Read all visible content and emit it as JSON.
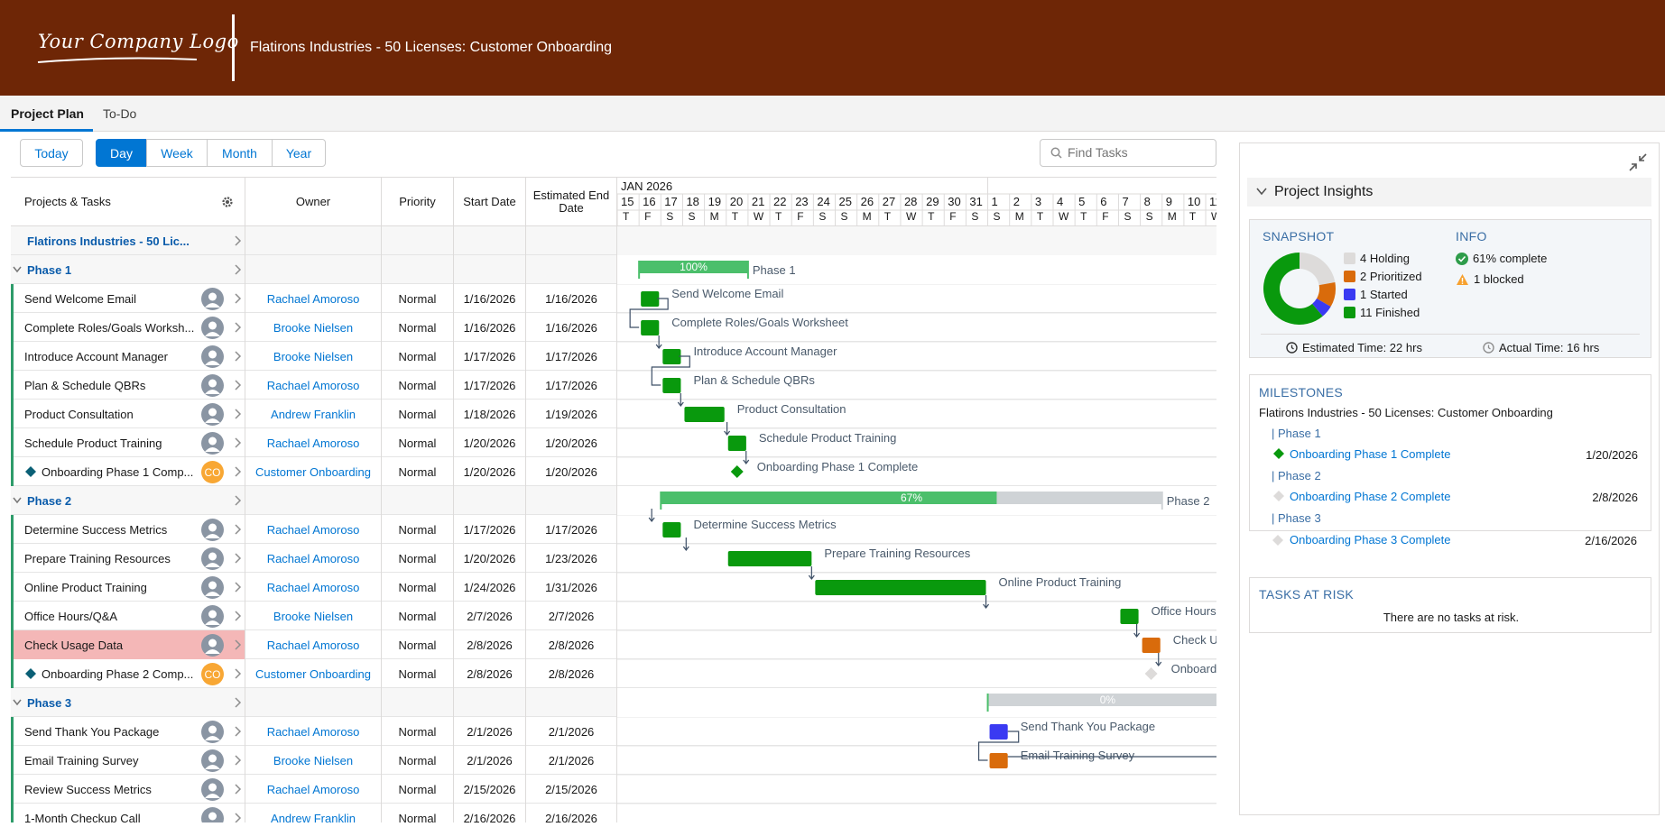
{
  "header": {
    "logo_text": "Your Company Logo",
    "title": "Flatirons Industries - 50 Licenses: Customer Onboarding"
  },
  "tabs": [
    {
      "label": "Project Plan",
      "active": true
    },
    {
      "label": "To-Do",
      "active": false
    }
  ],
  "toolbar": {
    "today": "Today",
    "views": [
      "Day",
      "Week",
      "Month",
      "Year"
    ],
    "active_view": "Day",
    "search_placeholder": "Find Tasks"
  },
  "grid": {
    "columns": [
      "Projects & Tasks",
      "Owner",
      "Priority",
      "Start Date",
      "Estimated End Date"
    ],
    "month_label": "JAN 2026",
    "days": [
      "15",
      "16",
      "17",
      "18",
      "19",
      "20",
      "21",
      "22",
      "23",
      "24",
      "25",
      "26",
      "27",
      "28",
      "29",
      "30",
      "31",
      "1",
      "2",
      "3",
      "4",
      "5",
      "6",
      "7",
      "8",
      "9",
      "10",
      "11"
    ],
    "weekdays": [
      "T",
      "F",
      "S",
      "S",
      "M",
      "T",
      "W",
      "T",
      "F",
      "S",
      "S",
      "M",
      "T",
      "W",
      "T",
      "F",
      "S",
      "S",
      "M",
      "T",
      "W",
      "T",
      "F",
      "S",
      "S",
      "M",
      "T",
      "W"
    ],
    "rows": [
      {
        "type": "project",
        "name": "Flatirons Industries - 50 Lic..."
      },
      {
        "type": "phase",
        "name": "Phase 1",
        "bar_label": "100%",
        "percent": 100,
        "gantt_label": "Phase 1"
      },
      {
        "type": "task",
        "name": "Send Welcome Email",
        "owner": "Rachael Amoroso",
        "priority": "Normal",
        "start": "1/16/2026",
        "end": "1/16/2026",
        "status": "finished"
      },
      {
        "type": "task",
        "name": "Complete Roles/Goals Worksh...",
        "gantt_label": "Complete Roles/Goals Worksheet",
        "owner": "Brooke Nielsen",
        "priority": "Normal",
        "start": "1/16/2026",
        "end": "1/16/2026",
        "status": "finished"
      },
      {
        "type": "task",
        "name": "Introduce Account Manager",
        "owner": "Brooke Nielsen",
        "priority": "Normal",
        "start": "1/17/2026",
        "end": "1/17/2026",
        "status": "finished"
      },
      {
        "type": "task",
        "name": "Plan & Schedule QBRs",
        "owner": "Rachael Amoroso",
        "priority": "Normal",
        "start": "1/17/2026",
        "end": "1/17/2026",
        "status": "finished"
      },
      {
        "type": "task",
        "name": "Product Consultation",
        "owner": "Andrew Franklin",
        "priority": "Normal",
        "start": "1/18/2026",
        "end": "1/19/2026",
        "status": "finished"
      },
      {
        "type": "task",
        "name": "Schedule Product Training",
        "owner": "Rachael Amoroso",
        "priority": "Normal",
        "start": "1/20/2026",
        "end": "1/20/2026",
        "status": "finished"
      },
      {
        "type": "milestone",
        "name": "Onboarding Phase 1 Comp...",
        "gantt_label": "Onboarding Phase 1 Complete",
        "owner": "Customer Onboarding",
        "avatar_initials": "CO",
        "priority": "Normal",
        "start": "1/20/2026",
        "end": "1/20/2026",
        "status": "finished"
      },
      {
        "type": "phase",
        "name": "Phase 2",
        "bar_label": "67%",
        "percent": 67,
        "gantt_label": "Phase 2"
      },
      {
        "type": "task",
        "name": "Determine Success Metrics",
        "owner": "Rachael Amoroso",
        "priority": "Normal",
        "start": "1/17/2026",
        "end": "1/17/2026",
        "status": "finished"
      },
      {
        "type": "task",
        "name": "Prepare Training Resources",
        "owner": "Rachael Amoroso",
        "priority": "Normal",
        "start": "1/20/2026",
        "end": "1/23/2026",
        "status": "finished"
      },
      {
        "type": "task",
        "name": "Online Product Training",
        "owner": "Rachael Amoroso",
        "priority": "Normal",
        "start": "1/24/2026",
        "end": "1/31/2026",
        "status": "finished"
      },
      {
        "type": "task",
        "name": "Office Hours/Q&A",
        "gantt_label": "Office Hours",
        "owner": "Brooke Nielsen",
        "priority": "Normal",
        "start": "2/7/2026",
        "end": "2/7/2026",
        "status": "finished"
      },
      {
        "type": "task",
        "name": "Check Usage Data",
        "gantt_label": "Check U",
        "owner": "Rachael Amoroso",
        "priority": "Normal",
        "start": "2/8/2026",
        "end": "2/8/2026",
        "status": "prioritized",
        "at_risk_highlight": true
      },
      {
        "type": "milestone",
        "name": "Onboarding Phase 2 Comp...",
        "gantt_label": "Onboard",
        "owner": "Customer Onboarding",
        "avatar_initials": "CO",
        "priority": "Normal",
        "start": "2/8/2026",
        "end": "2/8/2026",
        "status": "holding"
      },
      {
        "type": "phase",
        "name": "Phase 3",
        "bar_label": "0%",
        "percent": 0
      },
      {
        "type": "task",
        "name": "Send Thank You Package",
        "owner": "Rachael Amoroso",
        "priority": "Normal",
        "start": "2/1/2026",
        "end": "2/1/2026",
        "status": "started"
      },
      {
        "type": "task",
        "name": "Email Training Survey",
        "owner": "Brooke Nielsen",
        "priority": "Normal",
        "start": "2/1/2026",
        "end": "2/1/2026",
        "status": "prioritized"
      },
      {
        "type": "task",
        "name": "Review Success Metrics",
        "owner": "Rachael Amoroso",
        "priority": "Normal",
        "start": "2/15/2026",
        "end": "2/15/2026",
        "status": "holding"
      },
      {
        "type": "task",
        "name": "1-Month Checkup Call",
        "owner": "Andrew Franklin",
        "priority": "Normal",
        "start": "2/16/2026",
        "end": "2/16/2026",
        "status": "holding"
      }
    ]
  },
  "insights": {
    "title": "Project Insights",
    "snapshot_label": "SNAPSHOT",
    "info_label": "INFO",
    "legend": [
      {
        "label": "4 Holding",
        "count": 4,
        "color": "#dddbda"
      },
      {
        "label": "2 Prioritized",
        "count": 2,
        "color": "#d96b0b"
      },
      {
        "label": "1 Started",
        "count": 1,
        "color": "#3a3af2"
      },
      {
        "label": "11 Finished",
        "count": 11,
        "color": "#09990d"
      }
    ],
    "info": [
      {
        "icon": "check-circle-icon",
        "text": "61% complete"
      },
      {
        "icon": "warning-icon",
        "text": "1 blocked"
      }
    ],
    "estimated_time": "Estimated Time: 22 hrs",
    "actual_time": "Actual Time: 16 hrs"
  },
  "milestones": {
    "title": "MILESTONES",
    "project": "Flatirons Industries - 50 Licenses: Customer Onboarding",
    "items": [
      {
        "phase": "Phase 1",
        "name": "Onboarding Phase 1 Complete",
        "date": "1/20/2026",
        "done": true
      },
      {
        "phase": "Phase 2",
        "name": "Onboarding Phase 2 Complete",
        "date": "2/8/2026",
        "done": false
      },
      {
        "phase": "Phase 3",
        "name": "Onboarding Phase 3 Complete",
        "date": "2/16/2026",
        "done": false
      }
    ]
  },
  "tasks_at_risk": {
    "title": "TASKS AT RISK",
    "message": "There are no tasks at risk."
  },
  "colors": {
    "header_bg": "#6e2606",
    "finished": "#09990d",
    "phase_bar": "#4bbf6b",
    "prioritized": "#d96b0b",
    "started": "#3a3af2",
    "holding": "#dddbda",
    "accent": "#0176d3"
  }
}
